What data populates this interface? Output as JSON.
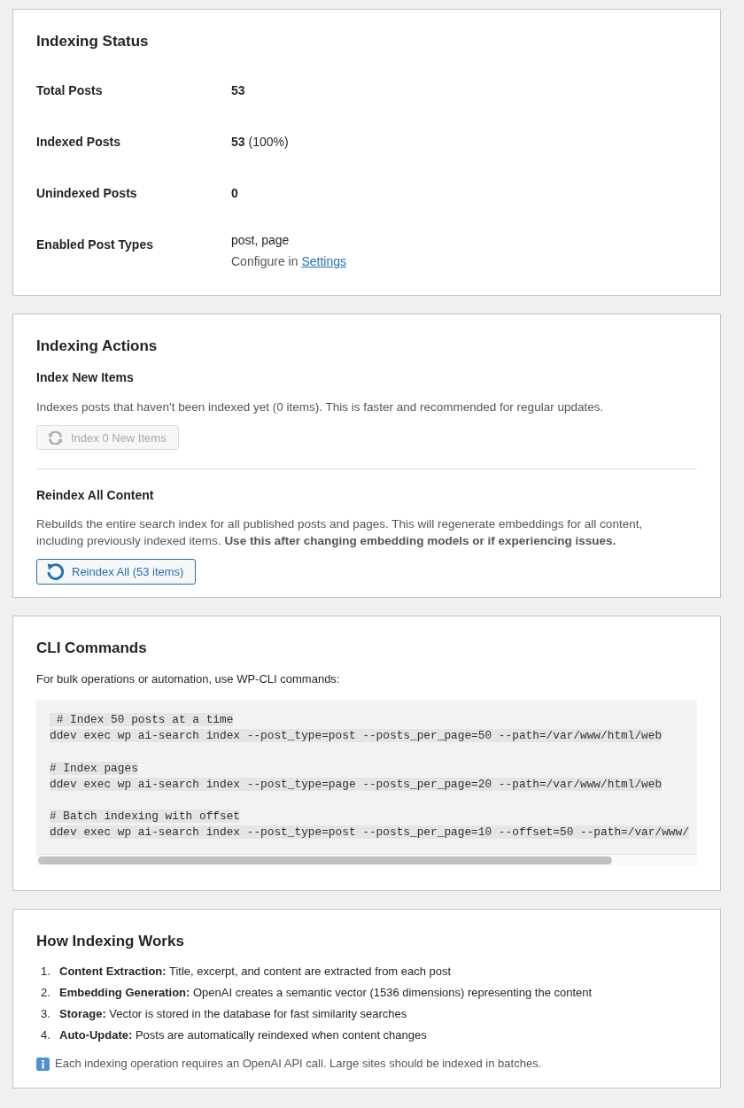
{
  "status_card": {
    "title": "Indexing Status",
    "rows": [
      {
        "kind": "count",
        "label": "Total Posts",
        "value": "53"
      },
      {
        "kind": "count",
        "label": "Indexed Posts",
        "value": "53",
        "note": "(100%)"
      },
      {
        "kind": "count",
        "label": "Unindexed Posts",
        "value": "0"
      },
      {
        "kind": "list",
        "label": "Enabled Post Types",
        "value": "post, page",
        "hint": "Configure in",
        "link": "Settings"
      }
    ]
  },
  "actions_card": {
    "title": "Indexing Actions",
    "actions": [
      {
        "kind": "incremental",
        "title": "Index New Items",
        "description": "Indexes posts that haven't been indexed yet (0 items). This is faster and recommended for regular updates.",
        "button": {
          "label": "Index 0 New Items",
          "disabled": true
        }
      },
      {
        "kind": "full",
        "title": "Reindex All Content",
        "description": "Rebuilds the entire search index for all published posts and pages. This will regenerate embeddings for all content, including previously indexed items. **Use this after changing embedding models or if experiencing issues.**",
        "button": {
          "label": "Reindex All (53 items)",
          "disabled": false
        }
      }
    ]
  },
  "cli_card": {
    "title": "CLI Commands",
    "description": "For bulk operations or automation, use WP-CLI commands:",
    "commands": [
      {
        "comment": " # Index 50 posts at a time",
        "command": "ddev exec wp ai-search index --post_type=post --posts_per_page=50 --path=/var/www/html/web"
      },
      {
        "comment": "# Index pages",
        "command": "ddev exec wp ai-search index --post_type=page --posts_per_page=20 --path=/var/www/html/web"
      },
      {
        "comment": "# Batch indexing with offset",
        "command": "ddev exec wp ai-search index --post_type=post --posts_per_page=10 --offset=50 --path=/var/www/"
      }
    ]
  },
  "how_card": {
    "title": "How Indexing Works",
    "steps": [
      {
        "number": "1.",
        "text": "**Content Extraction:** Title, excerpt, and content are extracted from each post"
      },
      {
        "number": "2.",
        "text": "**Embedding Generation:** OpenAI creates a semantic vector (1536 dimensions) representing the content"
      },
      {
        "number": "3.",
        "text": "**Storage:** Vector is stored in the database for fast similarity searches"
      },
      {
        "number": "4.",
        "text": "**Auto-Update:** Posts are automatically reindexed when content changes"
      }
    ],
    "note": "Each indexing operation requires an OpenAI API call. Large sites should be indexed in batches."
  }
}
